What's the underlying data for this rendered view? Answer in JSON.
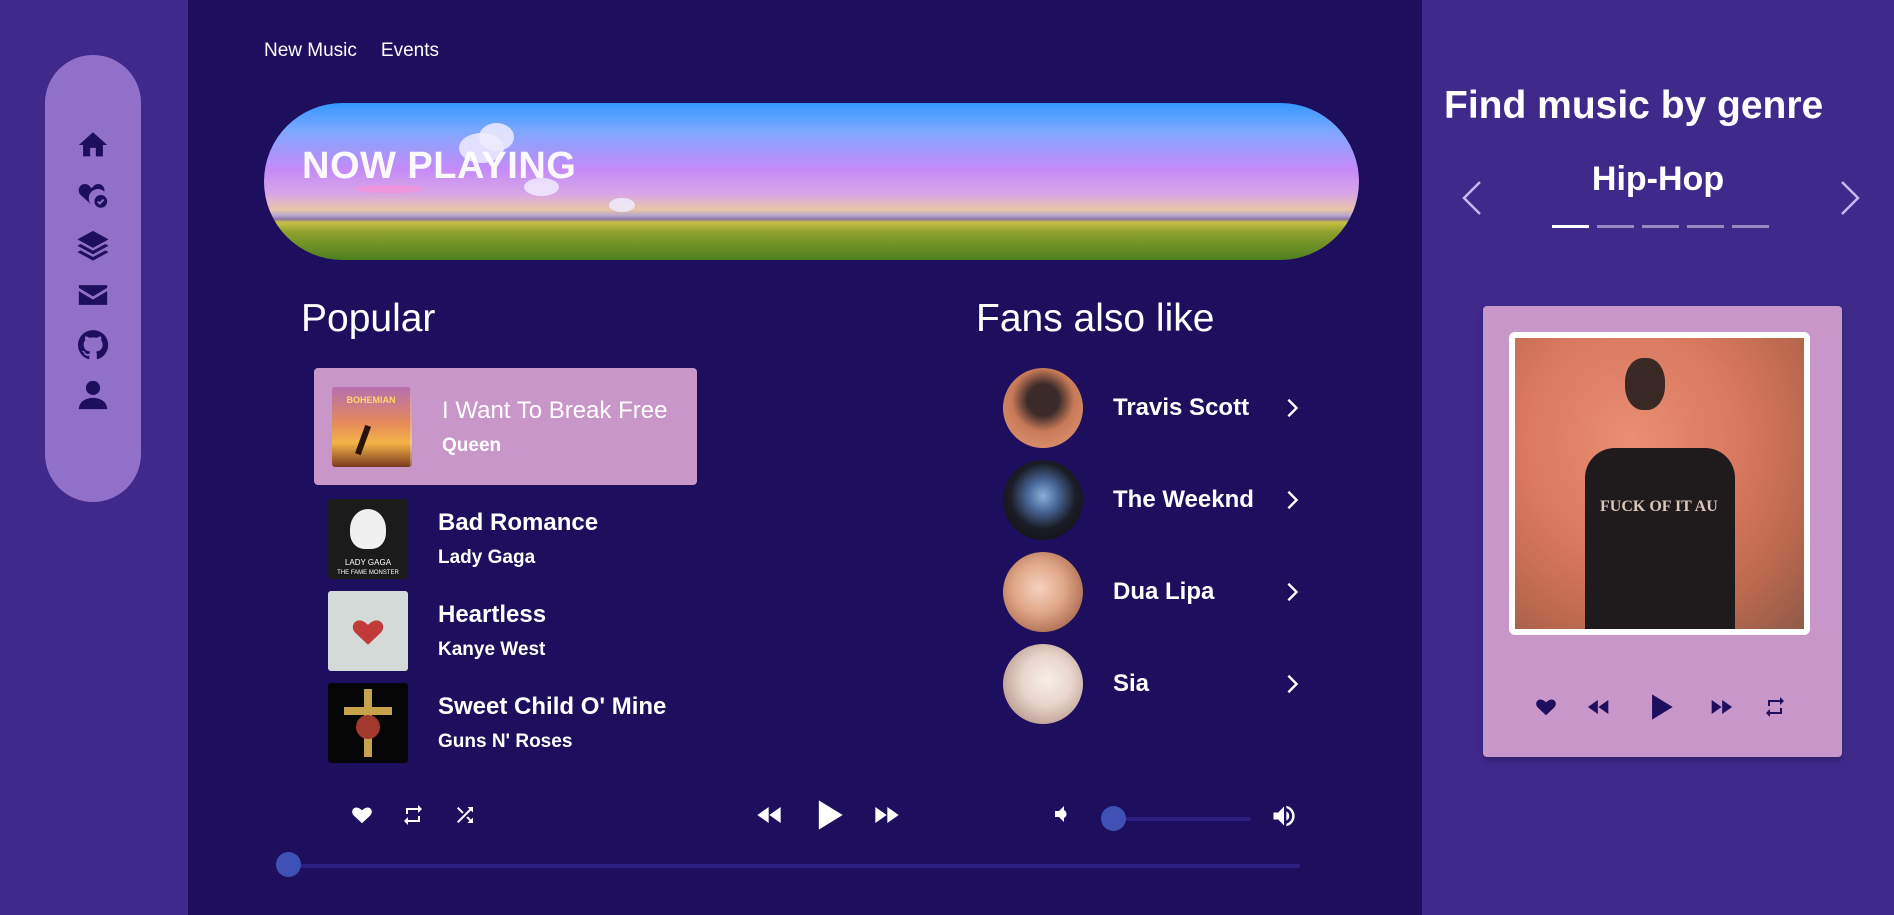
{
  "nav": {
    "links": [
      "New Music",
      "Events"
    ],
    "icons": [
      "home-icon",
      "heart-check-icon",
      "layers-icon",
      "mail-icon",
      "github-icon",
      "person-icon"
    ]
  },
  "banner": {
    "title": "NOW PLAYING"
  },
  "popular": {
    "title": "Popular",
    "songs": [
      {
        "title": "I Want To Break Free",
        "artist": "Queen",
        "active": true
      },
      {
        "title": "Bad Romance",
        "artist": "Lady Gaga"
      },
      {
        "title": "Heartless",
        "artist": "Kanye West"
      },
      {
        "title": "Sweet Child O' Mine",
        "artist": "Guns N' Roses"
      }
    ]
  },
  "fans": {
    "title": "Fans also like",
    "artists": [
      {
        "name": "Travis Scott"
      },
      {
        "name": "The Weeknd"
      },
      {
        "name": "Dua Lipa"
      },
      {
        "name": "Sia"
      }
    ]
  },
  "genre": {
    "heading": "Find music by genre",
    "current": "Hip-Hop",
    "total": 5,
    "active_index": 0
  },
  "player": {
    "volume_fraction": 0.0,
    "progress_fraction": 0.0
  },
  "album_covers": {
    "bohemian_text": "BOHEMIAN",
    "gaga_text": "LADY GAGA",
    "gaga_sub": "THE FAME MONSTER",
    "travis_shirt": "FUCK OF IT AU"
  },
  "colors": {
    "background": "#1e0e5e",
    "sidebar": "#3f2a8c",
    "pill": "#9070c8",
    "card": "#c896c9",
    "accent": "#3f51b5"
  }
}
